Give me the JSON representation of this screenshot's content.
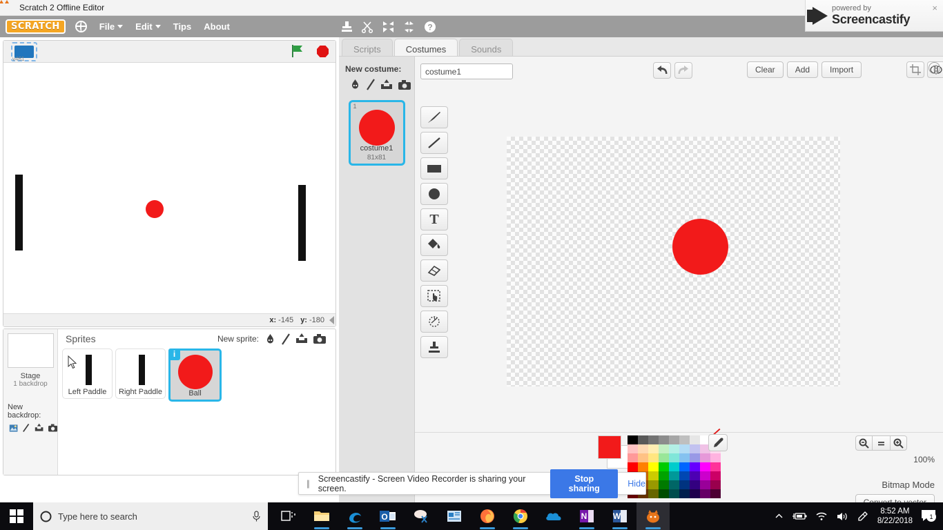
{
  "window": {
    "title": "Scratch 2 Offline Editor",
    "icon": "scratch-cat-icon"
  },
  "menubar": {
    "logo": "SCRATCH",
    "items": [
      {
        "label": "File",
        "has_caret": true
      },
      {
        "label": "Edit",
        "has_caret": true
      },
      {
        "label": "Tips",
        "has_caret": false
      },
      {
        "label": "About",
        "has_caret": false
      }
    ],
    "tools": [
      "stamp-duplicate-icon",
      "scissors-cut-icon",
      "grow-icon",
      "shrink-icon",
      "help-icon"
    ]
  },
  "screencastify_badge": {
    "small": "powered by",
    "big": "Screencastify",
    "close": "×"
  },
  "stage": {
    "version_label": "v461",
    "green_flag": "green-flag-icon",
    "stop": "stop-sign-icon",
    "coords": {
      "x_label": "x:",
      "x_value": "-145",
      "y_label": "y:",
      "y_value": "-180"
    }
  },
  "sprite_pane": {
    "stage_label": "Stage",
    "stage_sub": "1 backdrop",
    "new_backdrop_label": "New backdrop:",
    "new_backdrop_icons": [
      "library-icon",
      "paint-icon",
      "upload-icon",
      "camera-icon"
    ],
    "sprites_title": "Sprites",
    "new_sprite_label": "New sprite:",
    "new_sprite_icons": [
      "library-icon",
      "paint-icon",
      "upload-icon",
      "camera-icon"
    ],
    "sprites": [
      {
        "name": "Left Paddle",
        "selected": false,
        "art": "paddle"
      },
      {
        "name": "Right Paddle",
        "selected": false,
        "art": "paddle"
      },
      {
        "name": "Ball",
        "selected": true,
        "art": "ball",
        "info_badge": "i"
      }
    ]
  },
  "editor": {
    "tabs": [
      {
        "label": "Scripts",
        "active": false
      },
      {
        "label": "Costumes",
        "active": true
      },
      {
        "label": "Sounds",
        "active": false
      }
    ],
    "new_costume_label": "New costume:",
    "new_costume_icons": [
      "library-icon",
      "paint-icon",
      "upload-icon",
      "camera-icon"
    ],
    "costumes": [
      {
        "index": "1",
        "name": "costume1",
        "size": "81x81",
        "selected": true
      }
    ],
    "name_input": {
      "value": "costume1",
      "placeholder": "costume1"
    },
    "undo": "undo-icon",
    "redo": "redo-icon",
    "buttons": [
      {
        "label": "Clear",
        "name": "clear-button"
      },
      {
        "label": "Add",
        "name": "add-button"
      },
      {
        "label": "Import",
        "name": "import-button"
      }
    ],
    "transform_icons": [
      "crop-icon",
      "flip-horizontal-icon",
      "flip-vertical-icon",
      "set-center-icon"
    ],
    "tools": [
      "brush-tool",
      "line-tool",
      "rectangle-tool",
      "ellipse-tool",
      "text-tool",
      "fill-tool",
      "eraser-tool",
      "select-tool",
      "reshape-tool",
      "stamp-tool"
    ],
    "zoom": {
      "out": "zoom-out-icon",
      "reset": "zoom-reset-icon",
      "in": "zoom-in-icon",
      "percent": "100%"
    },
    "mode_label": "Bitmap Mode",
    "convert_button": "Convert to vector",
    "help_badge": "?",
    "current_color": "#f21a1a",
    "palette": [
      [
        "#000000",
        "#595959",
        "#737373",
        "#8c8c8c",
        "#a6a6a6",
        "#bfbfbf",
        "#d9d9d9",
        "#ffffff",
        "no-color"
      ],
      [
        "#ffc2c2",
        "#ffd9b3",
        "#ffeeb3",
        "#c2f0c2",
        "#b3f0e6",
        "#b3dcf5",
        "#c2c2f0",
        "#f0c2e6",
        "#ffd9ef"
      ],
      [
        "#ff9999",
        "#ffc285",
        "#ffe680",
        "#99e699",
        "#80e6d9",
        "#85c2f0",
        "#9999e6",
        "#e699d9",
        "#ffb3e0"
      ],
      [
        "#ff0000",
        "#ff8000",
        "#ffff00",
        "#00cc00",
        "#00cccc",
        "#0066ff",
        "#6600ff",
        "#ff00ff",
        "#ff3399"
      ],
      [
        "#cc0000",
        "#cc6600",
        "#cccc00",
        "#00a300",
        "#009999",
        "#0047b3",
        "#4d00b3",
        "#cc00cc",
        "#cc0066"
      ],
      [
        "#990000",
        "#995200",
        "#999900",
        "#007a00",
        "#006666",
        "#003380",
        "#330080",
        "#990099",
        "#99004d"
      ],
      [
        "#660000",
        "#663300",
        "#666600",
        "#004d00",
        "#004d4d",
        "#001f4d",
        "#1f004d",
        "#660066",
        "#4d0033"
      ]
    ]
  },
  "sharebar": {
    "message": "Screencastify - Screen Video Recorder is sharing your screen.",
    "stop_label": "Stop sharing",
    "hide_label": "Hide"
  },
  "taskbar": {
    "start": "windows-start-icon",
    "search_placeholder": "Type here to search",
    "mic": "microphone-icon",
    "apps": [
      {
        "name": "task-view-icon",
        "open": false
      },
      {
        "name": "file-explorer-icon",
        "open": true
      },
      {
        "name": "edge-icon",
        "open": true
      },
      {
        "name": "outlook-icon",
        "open": true
      },
      {
        "name": "snipping-tool-icon",
        "open": false
      },
      {
        "name": "publisher-icon",
        "open": false
      },
      {
        "name": "firefox-icon",
        "open": true
      },
      {
        "name": "chrome-icon",
        "open": true
      },
      {
        "name": "onedrive-icon",
        "open": false
      },
      {
        "name": "onenote-icon",
        "open": true
      },
      {
        "name": "word-icon",
        "open": true
      },
      {
        "name": "scratch-icon",
        "open": true,
        "active": true
      }
    ],
    "tray": [
      "chevron-up-icon",
      "battery-icon",
      "wifi-icon",
      "volume-icon",
      "pen-bluetooth-icon"
    ],
    "clock": {
      "time": "8:52 AM",
      "date": "8/22/2018"
    },
    "notifications": {
      "icon": "action-center-icon",
      "count": "1"
    }
  }
}
